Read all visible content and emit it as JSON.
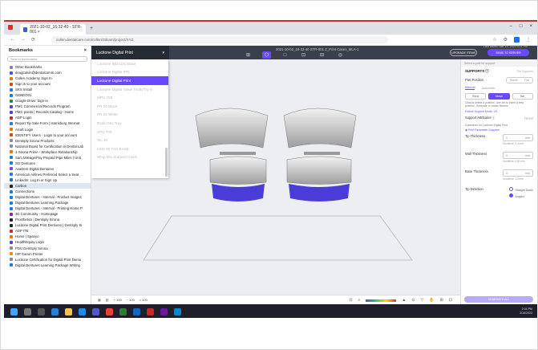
{
  "browser": {
    "tab_title": "2021-10-02_16-32-40 - STR-001 ×",
    "new_tab": "+",
    "url": "cullen.dentalcare.com/cullen/3dcam/project/XYZ",
    "window_controls": [
      "–",
      "□",
      "×"
    ]
  },
  "bookmarks": {
    "title": "Bookmarks",
    "search_placeholder": "Search bookmarks",
    "items": [
      {
        "label": "Other Bookmarks",
        "color": "#888888"
      },
      {
        "label": "dougcalvin@dentalcomm.com",
        "color": "#3b5bdb"
      },
      {
        "label": "Cullen Academy Sign In",
        "color": "#e67700"
      },
      {
        "label": "Sign in to your account",
        "color": "#d9480f"
      },
      {
        "label": "SKS Install",
        "color": "#1c7ed6"
      },
      {
        "label": "GENEO01",
        "color": "#1c7ed6"
      },
      {
        "label": "Google Drive: Sign-in",
        "color": "#2b8a3e"
      },
      {
        "label": "PMC Commercial Records Program",
        "color": "#5f3dc4"
      },
      {
        "label": "PMC points | Records Catalog - Home",
        "color": "#5f3dc4"
      },
      {
        "label": "ADP Login",
        "color": "#c92a2a"
      },
      {
        "label": "Report Tip Sale Form | Harrisburg Internat",
        "color": "#1c7ed6"
      },
      {
        "label": "ASoft Login",
        "color": "#e67700"
      },
      {
        "label": "IDENTIFY Users - Login to your account",
        "color": "#d9480f"
      },
      {
        "label": "Dentsply Sirona Products",
        "color": "#868e96"
      },
      {
        "label": "National Board for Certification in Dental Lab",
        "color": "#868e96"
      },
      {
        "label": "1-Sirona Prime - Workplace Relationship",
        "color": "#e67700"
      },
      {
        "label": "Sam Mileage/Pay Prepaid Pipe Miles | Unit",
        "color": "#1c7ed6"
      },
      {
        "label": "SO Dentures",
        "color": "#1c7ed6"
      },
      {
        "label": "AvaDent Digital Dentures",
        "color": "#7048e8"
      },
      {
        "label": "American Airlines Preferred Select a Seat",
        "color": "#1c7ed6"
      },
      {
        "label": "LinkedIn: Log In or Sign Up",
        "color": "#1971c2"
      },
      {
        "label": "Carbon",
        "color": "#212529"
      },
      {
        "label": "Connections",
        "color": "#1c7ed6"
      },
      {
        "label": "Digital Dentures - Internal - Product Images",
        "color": "#1c7ed6"
      },
      {
        "label": "Digital Dentures Learning Package",
        "color": "#1c7ed6"
      },
      {
        "label": "Digital Dentures - Internal - Printing Home P",
        "color": "#1c7ed6"
      },
      {
        "label": "3D Community - Homepage",
        "color": "#862e9c"
      },
      {
        "label": "Prosthetics | Dentsply Sirona",
        "color": "#212529"
      },
      {
        "label": "Lucitone Digital Print Dentures | Dentsply Si",
        "color": "#212529"
      },
      {
        "label": "ADP ITE",
        "color": "#c92a2a"
      },
      {
        "label": "Home | Spanyo",
        "color": "#e67700"
      },
      {
        "label": "HealthEquity Login",
        "color": "#5f3dc4"
      },
      {
        "label": "PDU Dentsply Sirona",
        "color": "#868e96"
      },
      {
        "label": "ISP Canon Printer",
        "color": "#f08c00"
      },
      {
        "label": "Lucitone Certification for Digital Print Dentu",
        "color": "#868e96"
      },
      {
        "label": "Digital Dentures Learning Package Writing",
        "color": "#1c7ed6"
      }
    ],
    "selected_index": 21
  },
  "app": {
    "material": "Lucitone Digital Print",
    "file_name": "2021-10-02_16-32-40 STR-001 Z_Print Cases_MLA-1",
    "last_saved": "Last saved: Mar 16, 2023 5:21 PM",
    "upgrade_label": "UPGRADE ITEMS",
    "send_label": "SEND TO SERVER",
    "toolbar": [
      "⊞",
      "⬡",
      "□",
      "⊡",
      "⊟",
      "◎"
    ],
    "active_tool_index": 1
  },
  "material_menu": {
    "items": [
      {
        "label": "Lucitone IBD/LDC Base",
        "style": "faded"
      },
      {
        "label": "Lucitone Digital IPN",
        "style": "faded"
      },
      {
        "label": "Lucitone Digital Print",
        "style": "selected"
      },
      {
        "label": "Lucitone Digital Value Tooth/Try-In",
        "style": "faded"
      },
      {
        "label": "MPU 703",
        "style": "faded"
      },
      {
        "label": "PR 25 Black",
        "style": "faded"
      },
      {
        "label": "PR 25 White",
        "style": "faded"
      },
      {
        "label": "Rodin Mix Tray",
        "style": "faded"
      },
      {
        "label": "SPU 705",
        "style": "faded"
      },
      {
        "label": "SIL 30",
        "style": "faded"
      },
      {
        "label": "UMA 90 TAN BASE",
        "style": "faded"
      },
      {
        "label": "Whip Mix Surgical Guide",
        "style": "faded"
      }
    ]
  },
  "bottom_bar": {
    "left": [
      "▦",
      "▥",
      "+ 100",
      "− 100",
      "⌕ 100"
    ],
    "right": [
      "⊡",
      "⌕",
      "▲",
      "⊙",
      "▽",
      "✋",
      "⊞",
      "⊡"
    ]
  },
  "panel": {
    "hint": "Select a part for support",
    "supports_title": "SUPPORTS ⓘ",
    "tint_label": "Tint Supports",
    "part_position_label": "Part Position",
    "part_position_options": [
      "Stable",
      "Flat"
    ],
    "tabs": [
      "Manual",
      "Automatic"
    ],
    "mode_options": [
      "Rand",
      "Noise",
      "Bar"
    ],
    "active_mode_index": 1,
    "mode_help": "Click to define a position. Use ctrl to insert a new position. Generate to create fixtures.",
    "custom_link": "Fixture Support Mode: LR",
    "attributes_label": "Support Attributes ⓘ",
    "attributes_reset": "Reset",
    "guidelines": "Guidelines for Lucitone Digital Print",
    "print_parameter": "◉ Print Parameter Diagram",
    "fields": [
      {
        "label": "Tip Thickness",
        "value": "0",
        "unit": "mm",
        "note": "Guideline: 0.4 mm"
      },
      {
        "label": "Wall Thickness",
        "value": "0",
        "unit": "mm",
        "note": "Guideline: 0.50 mm"
      },
      {
        "label": "Base Thickness",
        "value": "0",
        "unit": "mm",
        "note": "Guideline: 1.0 mm"
      }
    ],
    "tip_direction_label": "Tip Direction",
    "tip_direction_options": [
      "Straight Down",
      "Angled"
    ],
    "tip_direction_selected": 1,
    "generate_label": "GENERATE ALL"
  },
  "taskbar": {
    "time": "2:04 PM",
    "date": "3/16/2023"
  }
}
